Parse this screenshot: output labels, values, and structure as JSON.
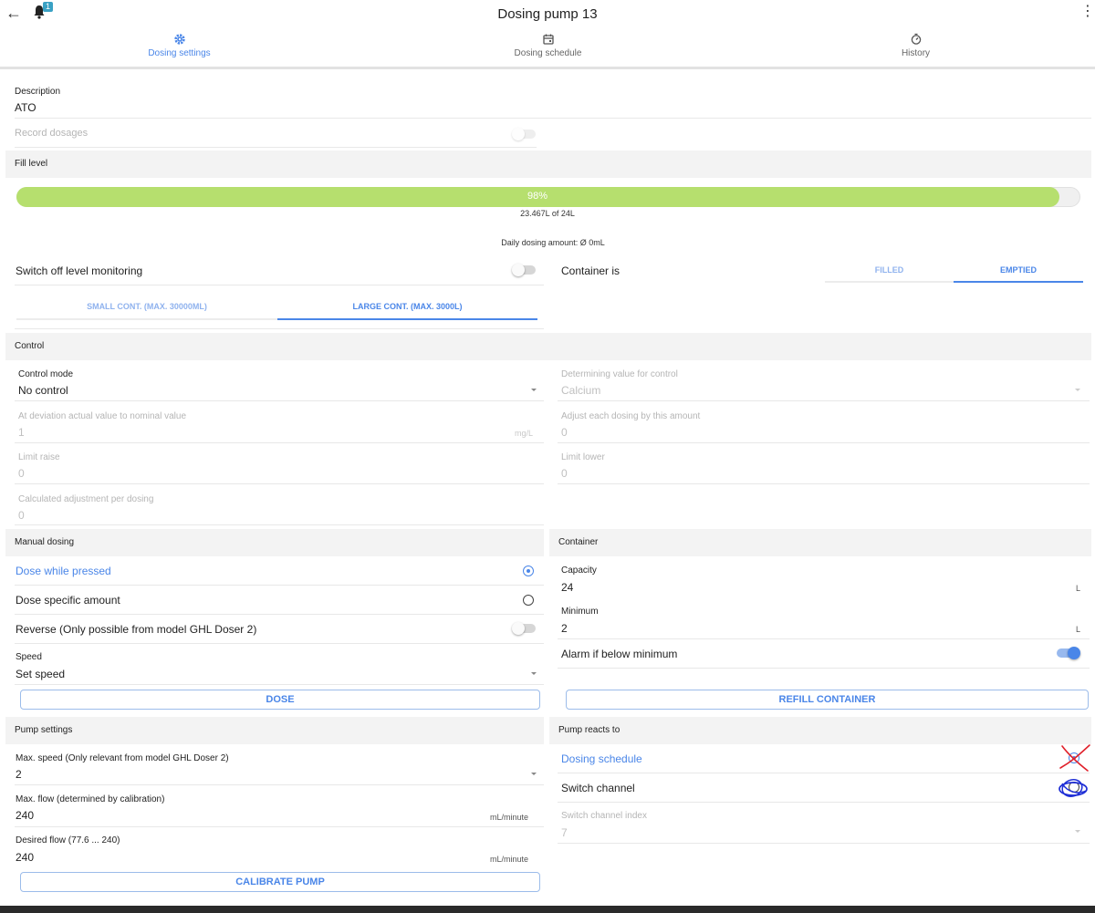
{
  "header": {
    "title": "Dosing pump 13",
    "notifications_count": "1"
  },
  "tabs": [
    {
      "label": "Dosing settings",
      "icon": "gear-icon",
      "active": true
    },
    {
      "label": "Dosing schedule",
      "icon": "calendar-icon",
      "active": false
    },
    {
      "label": "History",
      "icon": "history-icon",
      "active": false
    }
  ],
  "general": {
    "description_label": "Description",
    "description_value": "ATO",
    "record_dosages_label": "Record dosages"
  },
  "fill_level": {
    "header": "Fill level",
    "percent_text": "98%",
    "percent": 0.98,
    "amount_text": "23.467L of 24L",
    "daily_amount_text": "Daily dosing amount: Ø 0mL",
    "switch_off_label": "Switch off level monitoring",
    "container_is_label": "Container is",
    "container_filled": "FILLED",
    "container_emptied": "EMPTIED",
    "small_container": "SMALL CONT. (MAX. 30000ML)",
    "large_container": "LARGE CONT. (MAX. 3000L)"
  },
  "control": {
    "header": "Control",
    "mode_label": "Control mode",
    "mode_value": "No control",
    "determining_label": "Determining value for control",
    "determining_value": "Calcium",
    "deviation_label": "At deviation actual value to nominal value",
    "deviation_value": "1",
    "deviation_unit": "mg/L",
    "adjust_label": "Adjust each dosing by this amount",
    "adjust_value": "0",
    "limit_raise_label": "Limit raise",
    "limit_raise_value": "0",
    "limit_lower_label": "Limit lower",
    "limit_lower_value": "0",
    "calc_adjust_label": "Calculated adjustment per dosing",
    "calc_adjust_value": "0"
  },
  "manual_dosing": {
    "header": "Manual dosing",
    "dose_while_pressed": "Dose while pressed",
    "dose_specific": "Dose specific amount",
    "reverse": "Reverse (Only possible from model GHL Doser 2)",
    "speed_label": "Speed",
    "speed_value": "Set speed",
    "dose_button": "DOSE"
  },
  "container": {
    "header": "Container",
    "capacity_label": "Capacity",
    "capacity_value": "24",
    "capacity_unit": "L",
    "minimum_label": "Minimum",
    "minimum_value": "2",
    "minimum_unit": "L",
    "alarm_label": "Alarm if below minimum",
    "refill_button": "REFILL CONTAINER"
  },
  "pump_settings": {
    "header": "Pump settings",
    "max_speed_label": "Max. speed (Only relevant from model GHL Doser 2)",
    "max_speed_value": "2",
    "max_flow_label": "Max. flow (determined by calibration)",
    "max_flow_value": "240",
    "max_flow_unit": "mL/minute",
    "desired_flow_label": "Desired flow (77.6 ... 240)",
    "desired_flow_value": "240",
    "desired_flow_unit": "mL/minute",
    "calibrate_button": "CALIBRATE PUMP"
  },
  "pump_reacts": {
    "header": "Pump reacts to",
    "dosing_schedule": "Dosing schedule",
    "switch_channel": "Switch channel",
    "index_label": "Switch channel index",
    "index_value": "7"
  },
  "colors": {
    "accent": "#4a86e8",
    "progress": "#b6df6e",
    "annotation_red": "#e0202a",
    "annotation_blue": "#1f2fd6"
  }
}
